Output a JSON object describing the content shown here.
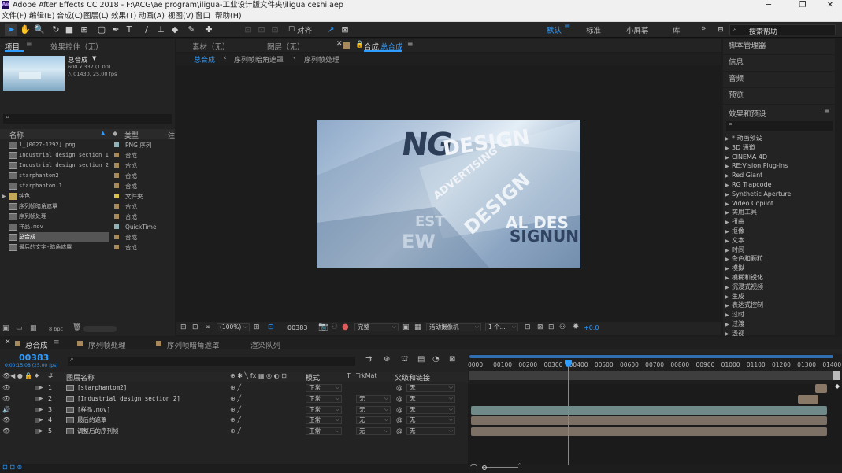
{
  "window": {
    "title": "Adobe After Effects CC 2018 - F:\\ACG\\ae program\\iligua-工业设计版文件夹\\iligua ceshi.aep",
    "logo_text": "Ae",
    "controls": [
      "─",
      "❐",
      "✕"
    ]
  },
  "menu": [
    "文件(F)",
    "编辑(E)",
    "合成(C)",
    "图层(L)",
    "效果(T)",
    "动画(A)",
    "视图(V)",
    "窗口",
    "帮助(H)"
  ],
  "toolbar": {
    "align_label": "对齐",
    "workspaces": [
      "默认",
      "标准",
      "小屏幕",
      "库"
    ],
    "active_workspace": "默认",
    "more": "»",
    "search_placeholder": "搜索帮助"
  },
  "project_panel": {
    "tab_project": "项目",
    "tab_effects_controls": "效果控件（无）",
    "selected_item": {
      "name": "总合成",
      "info1": "600 x 337 (1.00)",
      "info2": "△ 01430, 25.00 fps"
    },
    "columns": {
      "name": "名称",
      "type": "类型",
      "comment": "注"
    },
    "items": [
      {
        "name": "1_[0027-1292].png",
        "type": "PNG 序列",
        "color": "#8fb1b8"
      },
      {
        "name": "Industrial design section 1",
        "type": "合成",
        "color": "#a88a5a"
      },
      {
        "name": "Industrial design section 2",
        "type": "合成",
        "color": "#a88a5a"
      },
      {
        "name": "starphantom2",
        "type": "合成",
        "color": "#a88a5a"
      },
      {
        "name": "starphantom 1",
        "type": "合成",
        "color": "#a88a5a"
      },
      {
        "name": "纯色",
        "type": "文件夹",
        "color": "#d6c24a"
      },
      {
        "name": "序列帧暗角遮罩",
        "type": "合成",
        "color": "#a88a5a"
      },
      {
        "name": "序列帧处理",
        "type": "合成",
        "color": "#a88a5a"
      },
      {
        "name": "样品.mov",
        "type": "QuickTime",
        "color": "#8fb1b8"
      },
      {
        "name": "总合成",
        "type": "合成",
        "color": "#a88a5a",
        "selected": true
      },
      {
        "name": "最后的文字-暗角遮罩",
        "type": "合成",
        "color": "#a88a5a"
      }
    ],
    "footer_bpc": "8 bpc"
  },
  "viewer": {
    "tab_footage": "素材（无）",
    "tab_layer": "图层（无）",
    "tab_comp_prefix": "合成",
    "tab_comp_name": "总合成",
    "breadcrumbs": [
      "总合成",
      "序列帧暗角遮罩",
      "序列帧处理"
    ],
    "zoom": "(100%)",
    "timecode": "00383",
    "resolution": "完整",
    "camera": "活动摄像机",
    "views": "1 个...",
    "exposure": "+0.0",
    "preview_words": [
      "NG",
      "DESIGN",
      "ADVERTISING",
      "DESIGN",
      "EST",
      "AL DES",
      "EW",
      "SIGNUN"
    ]
  },
  "right_panels": {
    "items": [
      "脚本管理器",
      "信息",
      "音频",
      "预览"
    ],
    "effects_title": "效果和预设",
    "effects": [
      "* 动画预设",
      "3D 通道",
      "CINEMA 4D",
      "RE:Vision Plug-ins",
      "Red Giant",
      "RG Trapcode",
      "Synthetic Aperture",
      "Video Copilot",
      "实用工具",
      "扭曲",
      "抠像",
      "文本",
      "时间",
      "杂色和颗粒",
      "模拟",
      "模糊和锐化",
      "沉浸式视频",
      "生成",
      "表达式控制",
      "过时",
      "过渡",
      "透视"
    ]
  },
  "timeline": {
    "tabs": [
      "总合成",
      "序列帧处理",
      "序列帧暗角遮罩",
      "渲染队列"
    ],
    "active_tab": "总合成",
    "timecode": "00383",
    "timecode_sub": "0:00:15:08 (25.00 fps)",
    "columns": {
      "num": "#",
      "name": "图层名称",
      "mode": "模式",
      "t": "T",
      "trkmat": "TrkMat",
      "parent": "父级和链接"
    },
    "ruler": [
      "0000",
      "00100",
      "00200",
      "00300",
      "00400",
      "00500",
      "00600",
      "00700",
      "00800",
      "00900",
      "01000",
      "01100",
      "01200",
      "01300",
      "01400"
    ],
    "current_frame": 383,
    "total_frames": 1430,
    "layers": [
      {
        "num": "1",
        "name": "[starphantom2]",
        "mode": "正常",
        "trkmat": "",
        "parent": "无",
        "eye": "👁",
        "bar_start": 1360,
        "bar_end": 1430,
        "bar_color": "#8a7866"
      },
      {
        "num": "2",
        "name": "[Industrial design section 2]",
        "mode": "正常",
        "trkmat": "无",
        "parent": "无",
        "eye": "👁",
        "bar_start": 1290,
        "bar_end": 1370,
        "bar_color": "#8a7866"
      },
      {
        "num": "3",
        "name": "[样品.mov]",
        "mode": "正常",
        "trkmat": "无",
        "parent": "无",
        "eye": "🔊",
        "bar_start": 0,
        "bar_end": 1430,
        "bar_color": "#6f8a89"
      },
      {
        "num": "4",
        "name": "最后的遮罩",
        "mode": "正常",
        "trkmat": "无",
        "parent": "无",
        "eye": "👁",
        "bar_start": 0,
        "bar_end": 1430,
        "bar_color": "#7d7064"
      },
      {
        "num": "5",
        "name": "调整后的序列帧",
        "mode": "正常",
        "trkmat": "无",
        "parent": "无",
        "eye": "👁",
        "bar_start": 0,
        "bar_end": 1430,
        "bar_color": "#7d7064"
      }
    ]
  }
}
